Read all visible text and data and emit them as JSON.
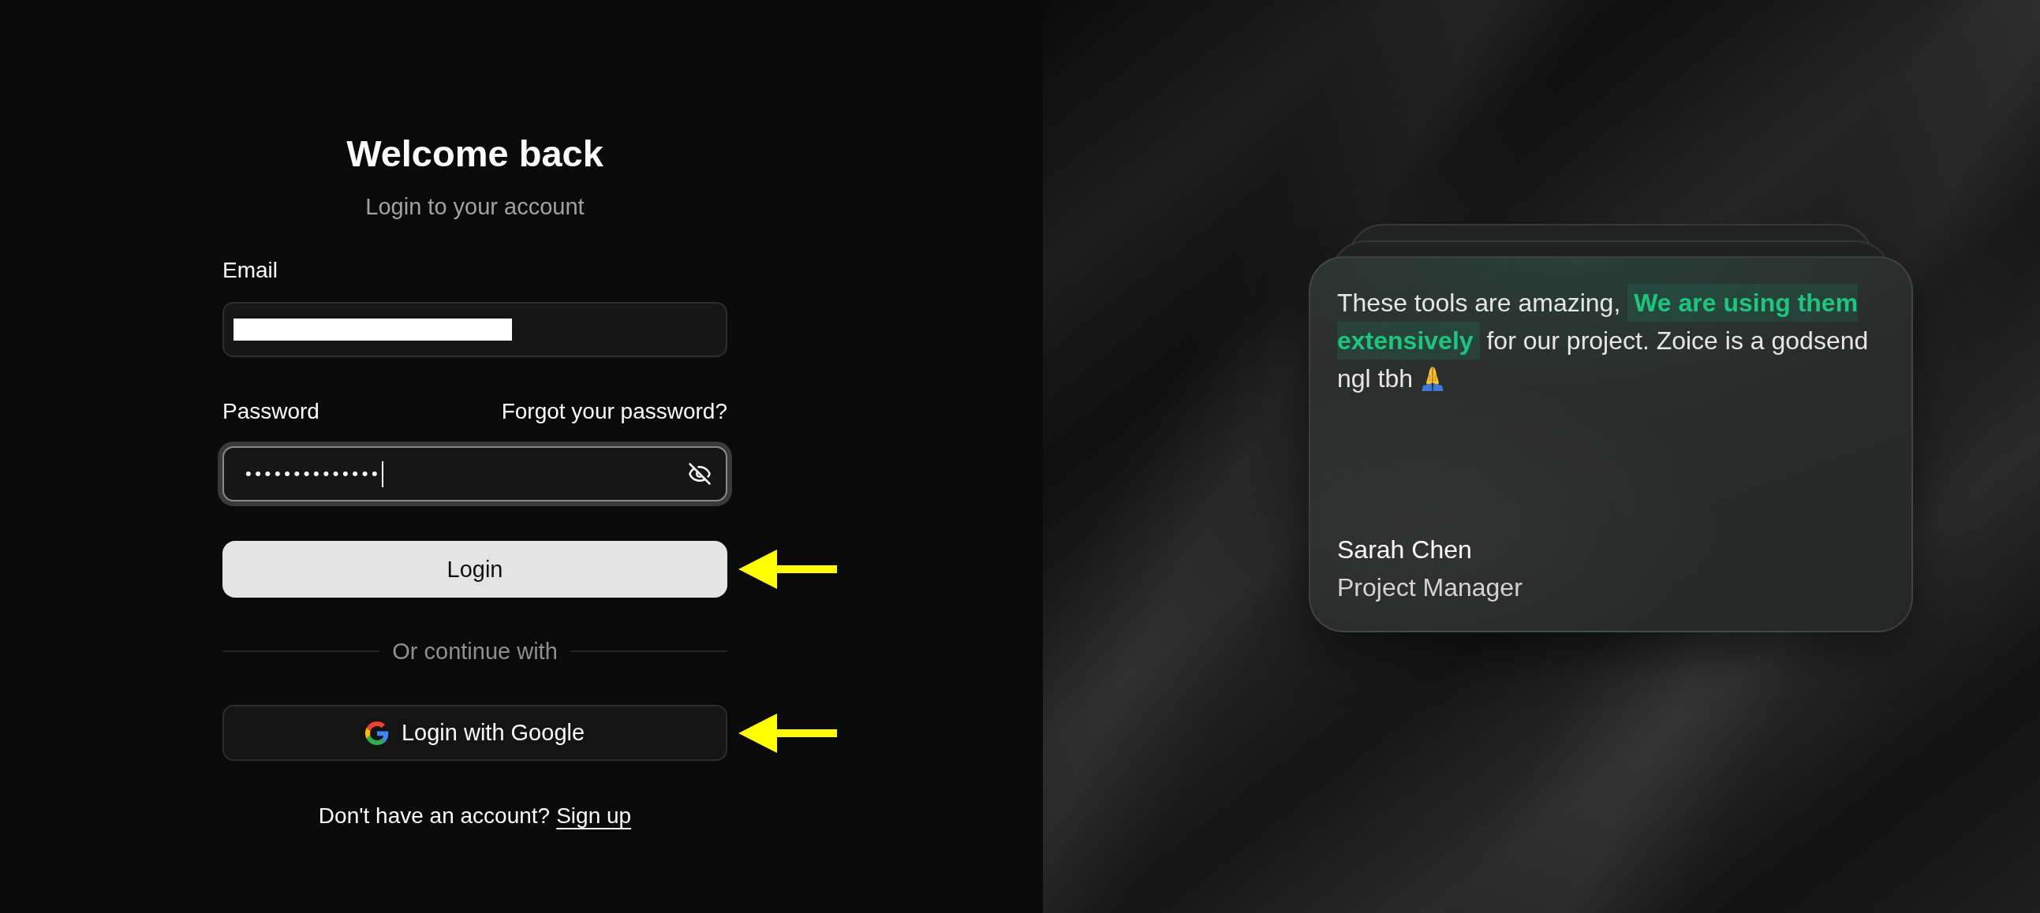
{
  "login_panel": {
    "title": "Welcome back",
    "subtitle": "Login to your account",
    "email": {
      "label": "Email",
      "redacted": true
    },
    "password": {
      "label": "Password",
      "forgot_link": "Forgot your password?",
      "value": "••••••••••••••",
      "focused": true,
      "visible": false
    },
    "login_button": {
      "label": "Login",
      "highlighted": true
    },
    "divider": "Or continue with",
    "google_button": {
      "label": "Login with Google",
      "highlighted": true
    },
    "signup": {
      "prompt": "Don't have an account?",
      "link": "Sign up"
    }
  },
  "testimonial": {
    "quote": "These tools are amazing, **We are using them extensively** for our project. Zoice is a godsend ngl tbh",
    "name": "Sarah Chen",
    "role": "Project Manager"
  }
}
